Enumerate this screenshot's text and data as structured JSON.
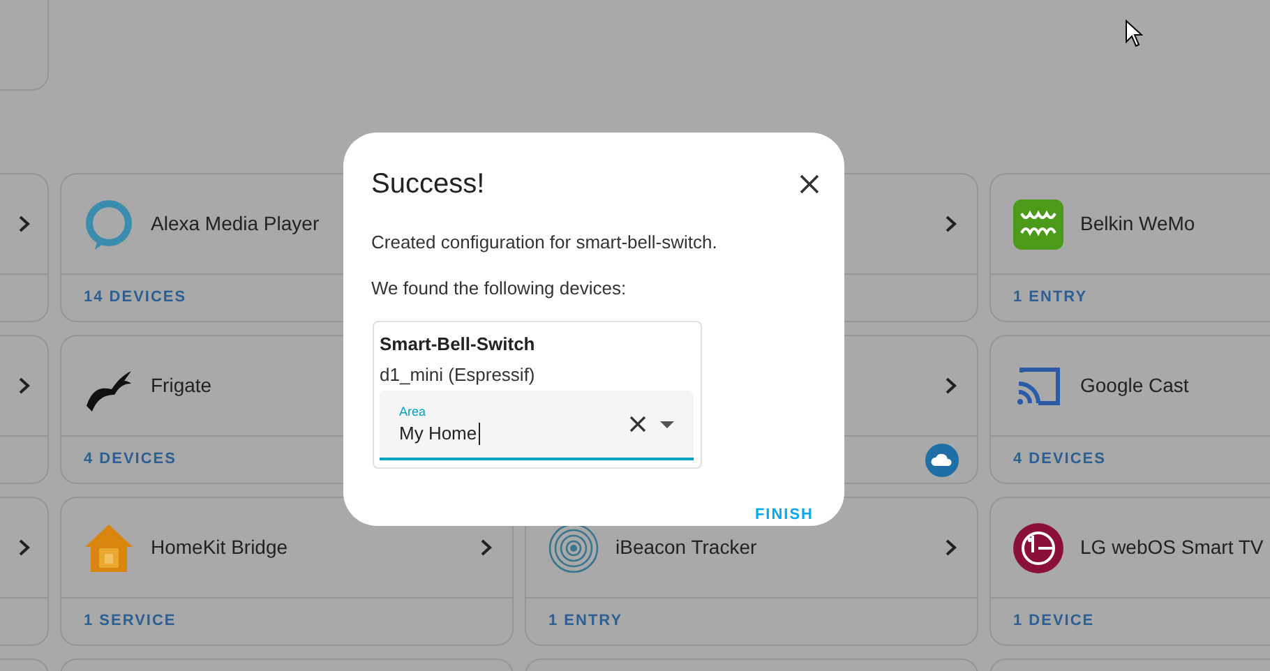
{
  "cards": [
    {
      "chevron": true
    },
    {
      "kind": "ring",
      "title": "Alexa Media Player",
      "count": "14 DEVICES",
      "chevron": false
    },
    {
      "chevron": true
    },
    {
      "kind": "wemo",
      "title": "Belkin WeMo",
      "count": "1 ENTRY",
      "chevron": false
    },
    {
      "chevron": true
    },
    {
      "kind": "bird",
      "title": "Frigate",
      "count": "4 DEVICES",
      "chevron": false
    },
    {
      "chevron": true,
      "cloud": true
    },
    {
      "kind": "cast",
      "title": "Google Cast",
      "count": "4 DEVICES",
      "chevron": false
    },
    {
      "chevron": true
    },
    {
      "kind": "house",
      "title": "HomeKit Bridge",
      "count": "1 SERVICE",
      "chevron": true
    },
    {
      "kind": "beacon",
      "title": "iBeacon Tracker",
      "count": "1 ENTRY",
      "chevron": true
    },
    {
      "kind": "lg",
      "title": "LG webOS Smart TV",
      "count": "1 DEVICE",
      "chevron": false
    }
  ],
  "dialog": {
    "title": "Success!",
    "message": "Created configuration for smart-bell-switch.",
    "devices_label": "We found the following devices:",
    "device": {
      "name": "Smart-Bell-Switch",
      "model": "d1_mini (Espressif)",
      "area": {
        "label": "Area",
        "value": "My Home"
      }
    },
    "finish_button": "FINISH"
  }
}
